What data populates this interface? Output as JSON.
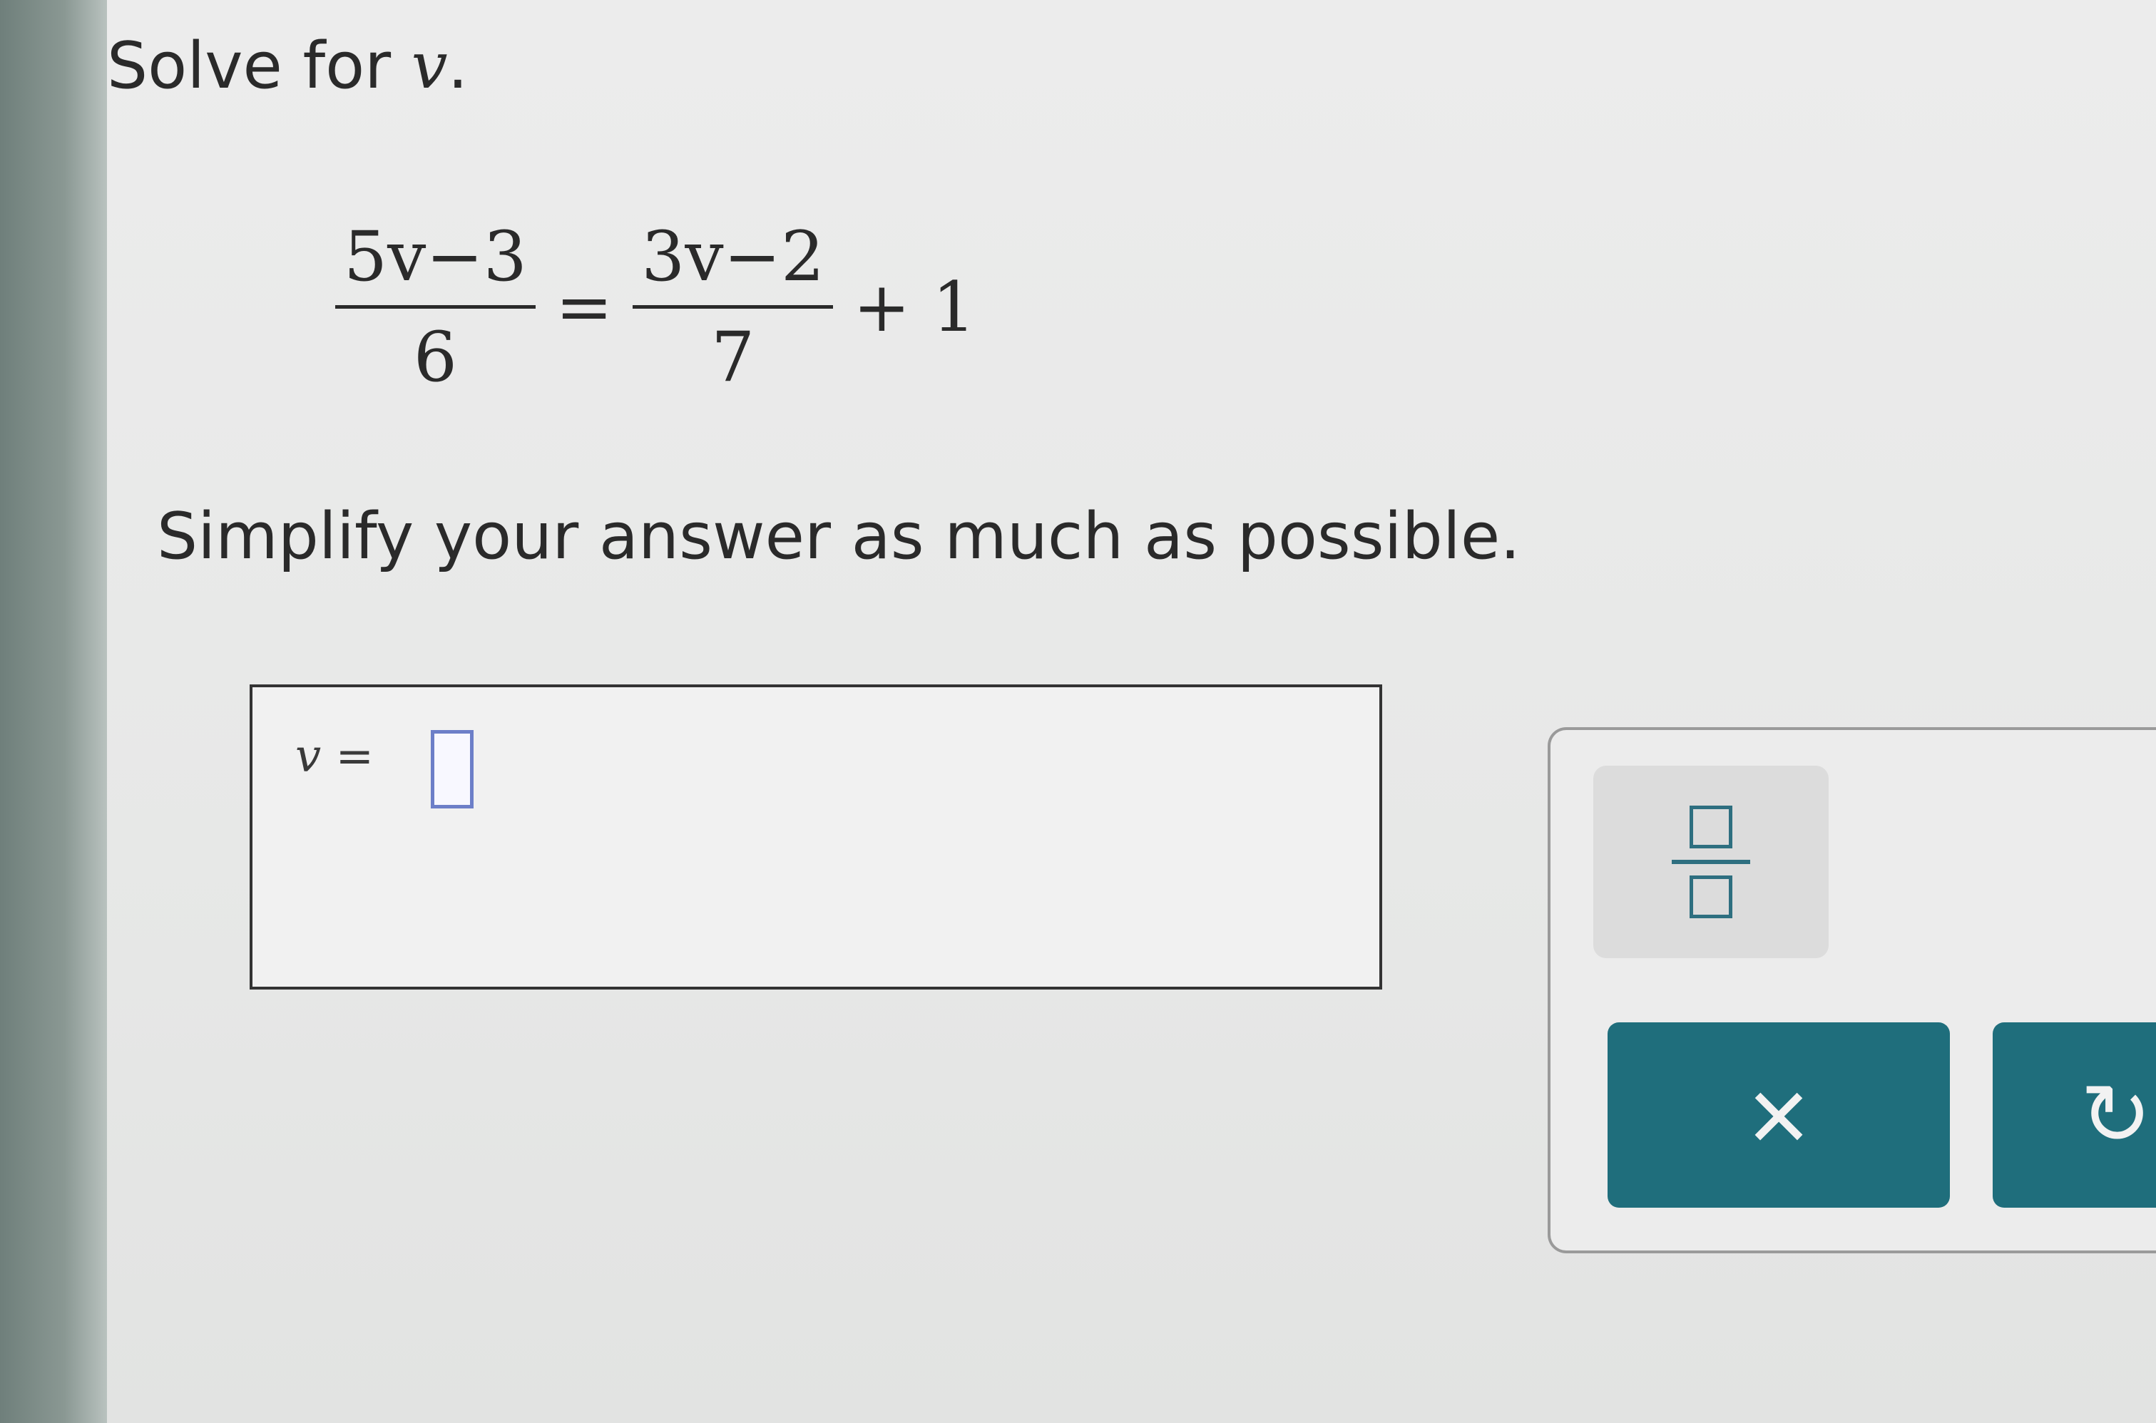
{
  "question": {
    "prefix": "Solve for ",
    "variable": "v",
    "suffix": "."
  },
  "equation": {
    "left_numerator": "5v−3",
    "left_denominator": "6",
    "equals": "=",
    "right_numerator": "3v−2",
    "right_denominator": "7",
    "plus_term": "+ 1"
  },
  "instruction": "Simplify your answer as much as possible.",
  "answer": {
    "variable": "v",
    "equals": "=",
    "value": ""
  },
  "toolbar": {
    "fraction_icon": "fraction-icon",
    "clear_label": "×",
    "next_label": "↻"
  },
  "colors": {
    "accent": "#1f6e7c",
    "input_slot": "#6d7fc8"
  }
}
